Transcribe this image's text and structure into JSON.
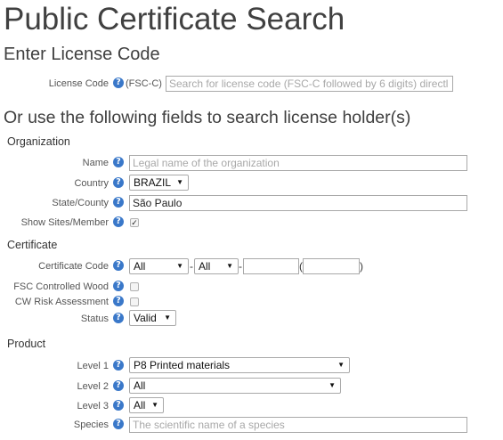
{
  "page": {
    "title": "Public Certificate Search",
    "license_heading": "Enter License Code",
    "fields_heading": "Or use the following fields to search license holder(s)"
  },
  "license": {
    "label": "License Code",
    "prefix": "(FSC-C)",
    "placeholder": "Search for license code (FSC-C followed by 6 digits) directl"
  },
  "organization": {
    "heading": "Organization",
    "name_label": "Name",
    "name_placeholder": "Legal name of the organization",
    "country_label": "Country",
    "country_value": "BRAZIL",
    "state_label": "State/County",
    "state_value": "São Paulo",
    "show_sites_label": "Show Sites/Member",
    "show_sites_checked": true
  },
  "certificate": {
    "heading": "Certificate",
    "code_label": "Certificate Code",
    "code_select1": "All",
    "code_select2": "All",
    "dash1": "-",
    "dash2": "-",
    "paren_open": "(",
    "paren_close": ")",
    "controlled_wood_label": "FSC Controlled Wood",
    "cw_risk_label": "CW Risk Assessment",
    "status_label": "Status",
    "status_value": "Valid"
  },
  "product": {
    "heading": "Product",
    "level1_label": "Level 1",
    "level1_value": "P8 Printed materials",
    "level2_label": "Level 2",
    "level2_value": "All",
    "level3_label": "Level 3",
    "level3_value": "All",
    "species_label": "Species",
    "species_placeholder": "The scientific name of a species"
  },
  "icons": {
    "help": "?",
    "dropdown": "▼",
    "check": "✓"
  },
  "colors": {
    "help_icon": "#3a78c9",
    "heading": "#404040"
  }
}
